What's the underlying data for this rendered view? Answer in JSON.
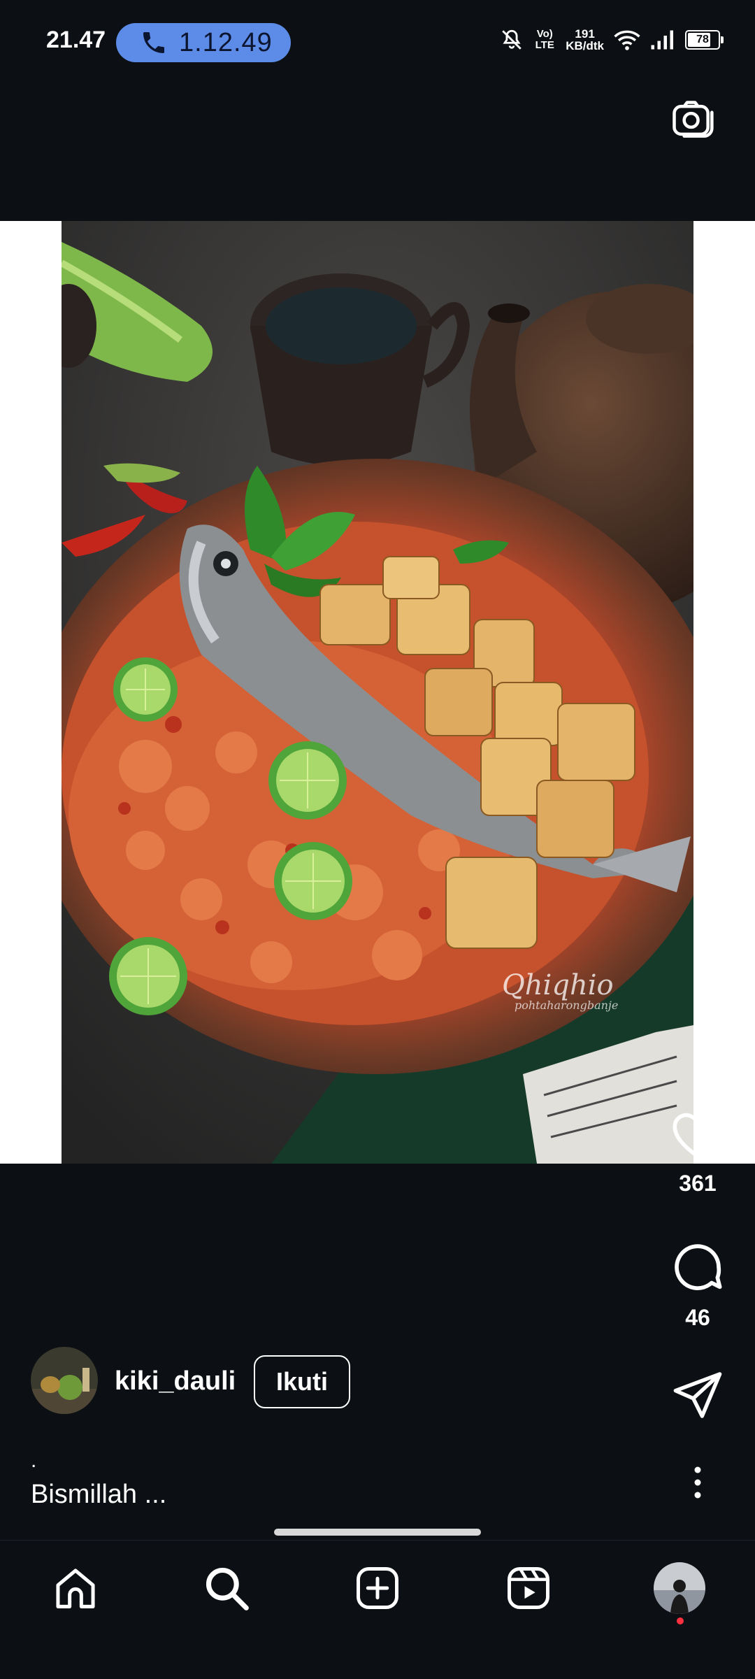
{
  "status_bar": {
    "time": "21.47",
    "call_duration": "1.12.49",
    "network_type": "Vo) LTE",
    "network_speed_value": "191",
    "network_speed_unit": "KB/dtk",
    "battery_level": "78",
    "battery_fraction": 0.78,
    "icons": [
      "mute-icon",
      "volte-icon",
      "wifi-icon",
      "signal-icon",
      "battery-icon"
    ]
  },
  "header": {
    "camera_icon": "camera-icon"
  },
  "post": {
    "image_alt": "Food photo: spicy prawn and fish dish with tofu and lime on clay plate",
    "watermark_script": "Qhiqhio",
    "watermark_sub": "pohtaharongbanje",
    "username": "kiki_dauli",
    "follow_label": "Ikuti",
    "caption_dot": ".",
    "caption": "Bismillah ..."
  },
  "actions": {
    "like_count": "361",
    "comment_count": "46"
  },
  "nav": {
    "items": [
      "home-icon",
      "search-icon",
      "add-post-icon",
      "reels-icon",
      "profile-avatar"
    ],
    "active": "search"
  },
  "colors": {
    "background": "#0c1014",
    "call_pill": "#5d8ce8",
    "notification_dot": "#ff3040"
  }
}
